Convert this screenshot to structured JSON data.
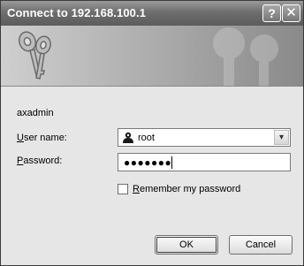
{
  "window": {
    "title": "Connect to 192.168.100.1",
    "help_label": "?",
    "close_label": "✕"
  },
  "realm": "axadmin",
  "fields": {
    "username_label_accel": "U",
    "username_label_rest": "ser name:",
    "username_value": "root",
    "password_label_accel": "P",
    "password_label_rest": "assword:",
    "password_mask": "●●●●●●●"
  },
  "remember": {
    "checked": false,
    "label_accel": "R",
    "label_rest": "emember my password"
  },
  "buttons": {
    "ok": "OK",
    "cancel": "Cancel"
  },
  "icons": {
    "banner": "keys-icon",
    "user": "user-icon",
    "dropdown": "chevron-down-icon"
  }
}
